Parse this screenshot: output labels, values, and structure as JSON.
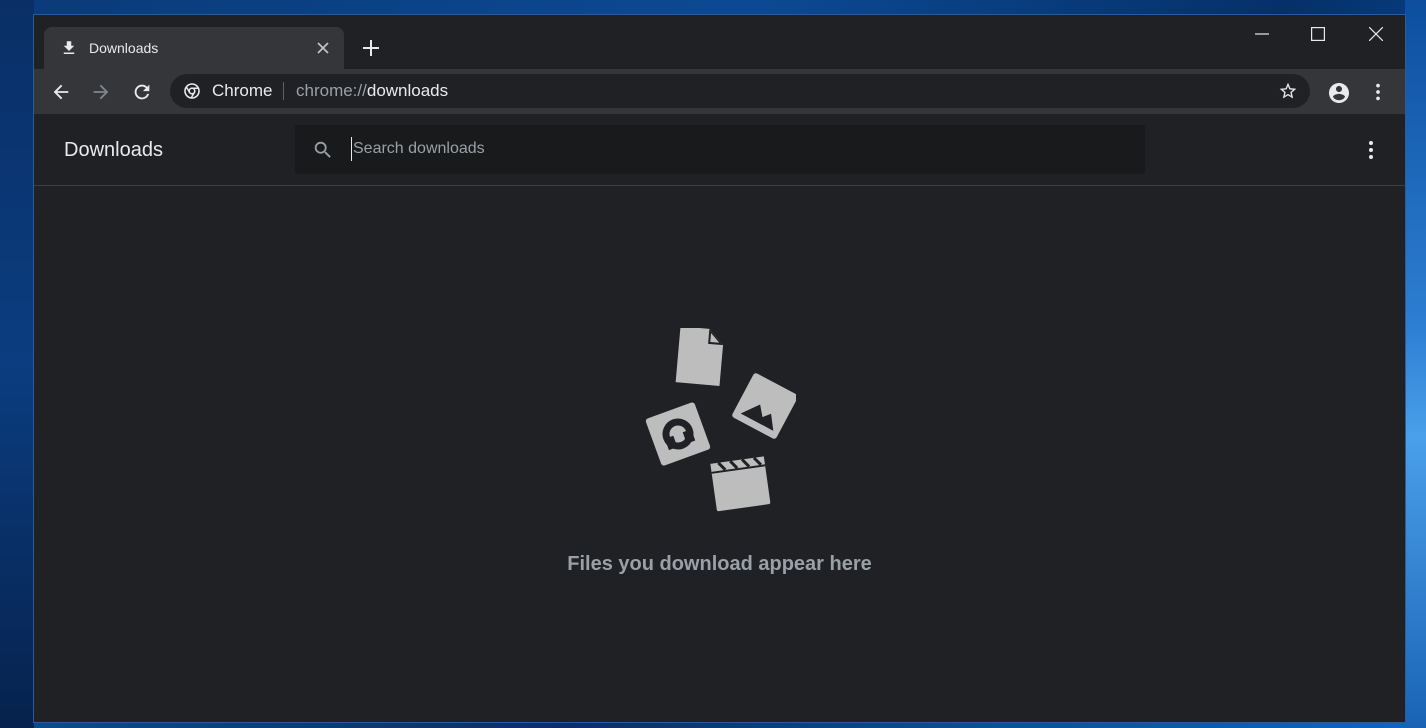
{
  "tab": {
    "title": "Downloads"
  },
  "omnibox": {
    "chip_label": "Chrome",
    "url_scheme": "chrome://",
    "url_host": "downloads"
  },
  "page": {
    "title": "Downloads",
    "search": {
      "placeholder": "Search downloads",
      "value": ""
    },
    "empty_message": "Files you download appear here"
  },
  "icons": {
    "tab": "download-icon",
    "close": "close-icon",
    "new_tab": "plus-icon",
    "back": "arrow-left-icon",
    "forward": "arrow-right-icon",
    "reload": "reload-icon",
    "site": "chrome-logo-icon",
    "bookmark": "star-icon",
    "profile": "account-icon",
    "menu": "more-vert-icon",
    "search": "search-icon"
  },
  "colors": {
    "background": "#202124",
    "toolbar": "#35363a",
    "text": "#e8eaed",
    "muted": "#9aa0a6",
    "illustration": "#bdbdbd"
  }
}
